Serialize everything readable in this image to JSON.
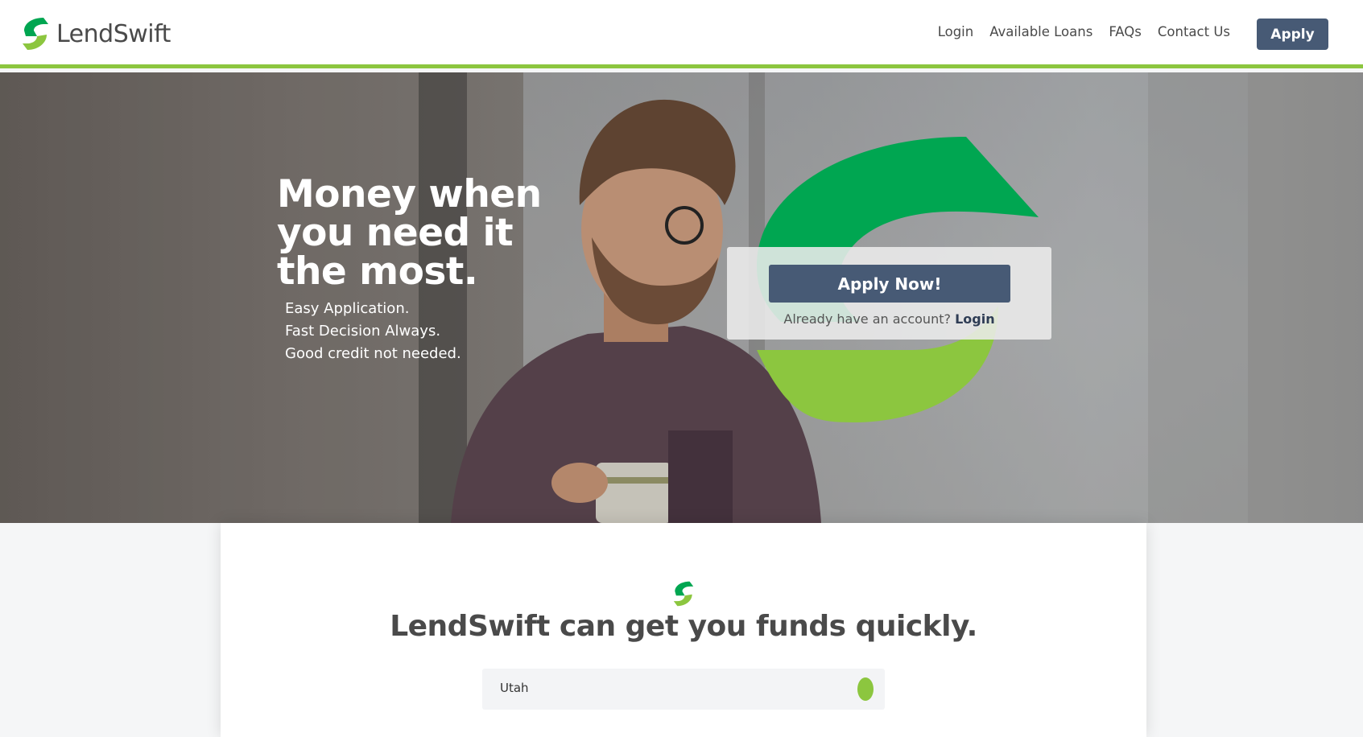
{
  "brand": {
    "name": "LendSwift",
    "green": "#8cc63f",
    "dark_green": "#00a651",
    "navy": "#475a75"
  },
  "nav": {
    "items": [
      "Login",
      "Available Loans",
      "FAQs",
      "Contact Us"
    ],
    "apply_label": "Apply"
  },
  "hero": {
    "title": "Money when you need it the most.",
    "bullets": [
      "Easy Application.",
      "Fast Decision Always.",
      "Good credit not needed."
    ],
    "apply_now_label": "Apply Now!",
    "account_prompt": "Already have an account?",
    "login_label": "Login"
  },
  "main": {
    "title": "LendSwift can get you funds quickly.",
    "state_select": {
      "selected": "Utah"
    }
  },
  "icons": {
    "logo": "lendswift-s-logo-icon",
    "select_indicator": "green-dot-icon"
  }
}
